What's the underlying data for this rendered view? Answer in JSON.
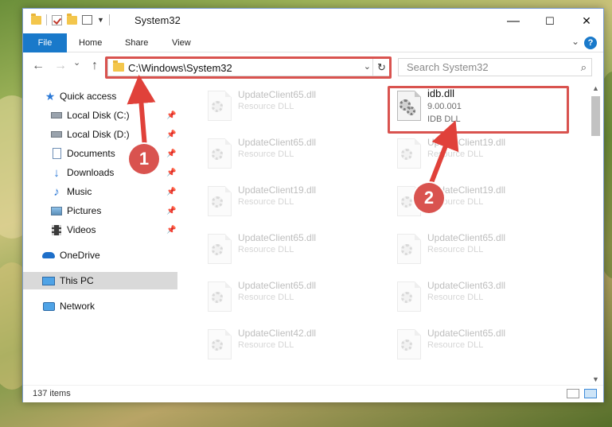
{
  "window": {
    "title": "System32",
    "minimize_glyph": "—",
    "maximize_glyph": "☐",
    "close_glyph": "✕"
  },
  "ribbon": {
    "tabs": [
      "File",
      "Home",
      "Share",
      "View"
    ],
    "expand_glyph": "⌄",
    "help_glyph": "?"
  },
  "nav": {
    "back_glyph": "←",
    "forward_glyph": "→",
    "recent_glyph": "⌄",
    "up_glyph": "↑",
    "address": "C:\\Windows\\System32",
    "address_dropdown_glyph": "⌄",
    "refresh_glyph": "↻",
    "search_placeholder": "Search System32",
    "search_glyph": "⌕"
  },
  "sidebar": {
    "items": [
      {
        "label": "Quick access",
        "icon": "star-icon"
      },
      {
        "label": "Local Disk (C:)",
        "icon": "drive-icon"
      },
      {
        "label": "Local Disk (D:)",
        "icon": "drive-icon"
      },
      {
        "label": "Documents",
        "icon": "documents-icon"
      },
      {
        "label": "Downloads",
        "icon": "downloads-icon"
      },
      {
        "label": "Music",
        "icon": "music-icon"
      },
      {
        "label": "Pictures",
        "icon": "pictures-icon"
      },
      {
        "label": "Videos",
        "icon": "videos-icon"
      },
      {
        "label": "OneDrive",
        "icon": "cloud-icon"
      },
      {
        "label": "This PC",
        "icon": "monitor-icon"
      },
      {
        "label": "Network",
        "icon": "network-icon"
      }
    ],
    "pin_glyph": "📌"
  },
  "files": [
    {
      "name": "UpdateClient65.dll",
      "type": "Resource DLL"
    },
    {
      "name": "idb.dll",
      "version": "9.00.001",
      "type": "IDB DLL"
    },
    {
      "name": "UpdateClient65.dll",
      "type": "Resource DLL"
    },
    {
      "name": "UpdateClient19.dll",
      "type": "Resource DLL"
    },
    {
      "name": "UpdateClient19.dll",
      "type": "Resource DLL"
    },
    {
      "name": "UpdateClient19.dll",
      "type": "Resource DLL"
    },
    {
      "name": "UpdateClient65.dll",
      "type": "Resource DLL"
    },
    {
      "name": "UpdateClient65.dll",
      "type": "Resource DLL"
    },
    {
      "name": "UpdateClient65.dll",
      "type": "Resource DLL"
    },
    {
      "name": "UpdateClient63.dll",
      "type": "Resource DLL"
    },
    {
      "name": "UpdateClient42.dll",
      "type": "Resource DLL"
    },
    {
      "name": "UpdateClient65.dll",
      "type": "Resource DLL"
    }
  ],
  "status": {
    "item_count": "137 items"
  },
  "callouts": [
    "1",
    "2"
  ],
  "colors": {
    "accent": "#1979ca",
    "highlight": "#d9534f"
  }
}
